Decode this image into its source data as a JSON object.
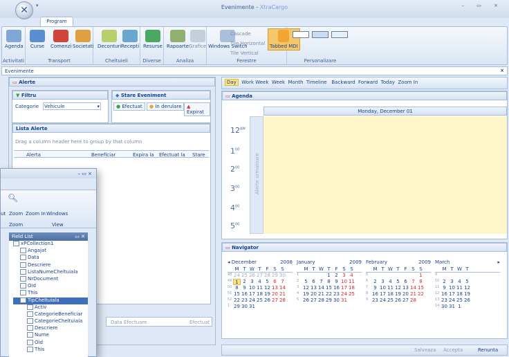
{
  "window": {
    "title_app": "Evenimente - ",
    "title_brand": "XtraCargo",
    "controls": "– ▭ ×"
  },
  "qat": "▾",
  "ribbon": {
    "tab": "Program",
    "groups": [
      {
        "label": "Activitati",
        "buttons": [
          "Agenda"
        ]
      },
      {
        "label": "Transport",
        "buttons": [
          "Curse",
          "Comenzi",
          "Societati"
        ]
      },
      {
        "label": "Cheltuieli",
        "buttons": [
          "Deconturi",
          "Recepti"
        ]
      },
      {
        "label": "Diverse",
        "buttons": [
          "Resurse"
        ]
      },
      {
        "label": "Analiza",
        "buttons": [
          "Rapoarte",
          "Grafice"
        ]
      },
      {
        "label": "Ferestre",
        "buttons": [
          "Windows Switch",
          "Cascade",
          "Tile Horizontal",
          "Tile Vertical",
          "Tabbed MDI"
        ]
      },
      {
        "label": "Personalizare",
        "buttons": []
      }
    ]
  },
  "doc_tab": "Evenimente",
  "alerts": {
    "panel_title": "Alerte",
    "filter_title": "Filtru",
    "status_title": "Stare Eveniment",
    "category_label": "Categorie",
    "category_value": "Vehicule",
    "btn_done": "Efectuat",
    "btn_progress": "In derulare",
    "btn_expired": "Expirat",
    "list_title": "Lista Alerte",
    "group_hint": "Drag a column header here to group by that column",
    "columns": [
      "Alerta",
      "Beneficiar",
      "Expira la",
      "Efectuat la",
      "Stare"
    ]
  },
  "scheduler": {
    "toolbar": [
      "Day",
      "Work Week",
      "Week",
      "Month",
      "Timeline",
      "Backward",
      "Forward",
      "Today",
      "Zoom In"
    ],
    "agenda_title": "Agenda",
    "day_header": "Monday, December 01",
    "hours": [
      "12",
      "1",
      "2",
      "3",
      "4",
      "5"
    ],
    "hour_suffixes": [
      "AM",
      "00",
      "00",
      "00",
      "00",
      "00"
    ],
    "side_label": "Alerte urmatoare"
  },
  "navigator": {
    "title": "Navigator",
    "months": [
      {
        "name": "December",
        "year": "2008",
        "weeks": [
          "48",
          "49",
          "50",
          "51",
          "52",
          "1"
        ],
        "days": [
          [
            "24",
            "25",
            "26",
            "27",
            "28",
            "29",
            "30"
          ],
          [
            "1",
            "2",
            "3",
            "4",
            "5",
            "6",
            "7"
          ],
          [
            "8",
            "9",
            "10",
            "11",
            "12",
            "13",
            "14"
          ],
          [
            "15",
            "16",
            "17",
            "18",
            "19",
            "20",
            "21"
          ],
          [
            "22",
            "23",
            "24",
            "25",
            "26",
            "27",
            "28"
          ],
          [
            "29",
            "30",
            "31",
            "",
            "",
            "",
            ""
          ]
        ]
      },
      {
        "name": "January",
        "year": "2009",
        "weeks": [
          "1",
          "2",
          "3",
          "4",
          "5",
          ""
        ],
        "days": [
          [
            "",
            "",
            "",
            "1",
            "2",
            "3",
            "4"
          ],
          [
            "5",
            "6",
            "7",
            "8",
            "9",
            "10",
            "11"
          ],
          [
            "12",
            "13",
            "14",
            "15",
            "16",
            "17",
            "18"
          ],
          [
            "19",
            "20",
            "21",
            "22",
            "23",
            "24",
            "25"
          ],
          [
            "26",
            "27",
            "28",
            "29",
            "30",
            "31",
            ""
          ],
          [
            "",
            "",
            "",
            "",
            "",
            "",
            ""
          ]
        ]
      },
      {
        "name": "February",
        "year": "2009",
        "weeks": [
          "5",
          "6",
          "7",
          "8",
          "9",
          ""
        ],
        "days": [
          [
            "",
            "",
            "",
            "",
            "",
            "",
            "1"
          ],
          [
            "2",
            "3",
            "4",
            "5",
            "6",
            "7",
            "8"
          ],
          [
            "9",
            "10",
            "11",
            "12",
            "13",
            "14",
            "15"
          ],
          [
            "16",
            "17",
            "18",
            "19",
            "20",
            "21",
            "22"
          ],
          [
            "23",
            "24",
            "25",
            "26",
            "27",
            "28",
            ""
          ],
          [
            "",
            "",
            "",
            "",
            "",
            "",
            ""
          ]
        ]
      },
      {
        "name": "March",
        "year": "",
        "weeks": [
          "9",
          "10",
          "11",
          "12",
          "13",
          "14"
        ],
        "days": [
          [
            "",
            "",
            "",
            ""
          ],
          [
            "2",
            "3",
            "4",
            "5"
          ],
          [
            "9",
            "10",
            "11",
            "12"
          ],
          [
            "16",
            "17",
            "18",
            "19"
          ],
          [
            "23",
            "24",
            "25",
            "26"
          ],
          [
            "30",
            "31",
            "1",
            ""
          ]
        ]
      }
    ],
    "weekdays": [
      "M",
      "T",
      "W",
      "T",
      "F",
      "S",
      "S"
    ]
  },
  "floating": {
    "title_controls": "– ▭ ×",
    "buttons": [
      "ut",
      "Zoom",
      "Zoom In",
      "Windows"
    ],
    "groups": [
      "Zoom",
      "View"
    ],
    "field_list_title": "Field List",
    "tree": [
      "xPCollection1",
      "Angajat",
      "Data",
      "Descriere",
      "ListaNumeCheltuiala",
      "NrDocument",
      "Oid",
      "This",
      "TipCheltuiala",
      "Activ",
      "CategorieBeneficiar",
      "CategorieCheltuiala",
      "Descriere",
      "Nume",
      "Oid",
      "This"
    ]
  },
  "footer": {
    "data_efectuare": "Data Efectuare",
    "efectuat": "Efectuat",
    "salveaza": "Salveaza",
    "accepta": "Accepta",
    "renunta": "Renunta"
  },
  "colors": {
    "accent": "#15428b",
    "highlight": "#f7e48a",
    "frame": "#dfe8f6"
  }
}
